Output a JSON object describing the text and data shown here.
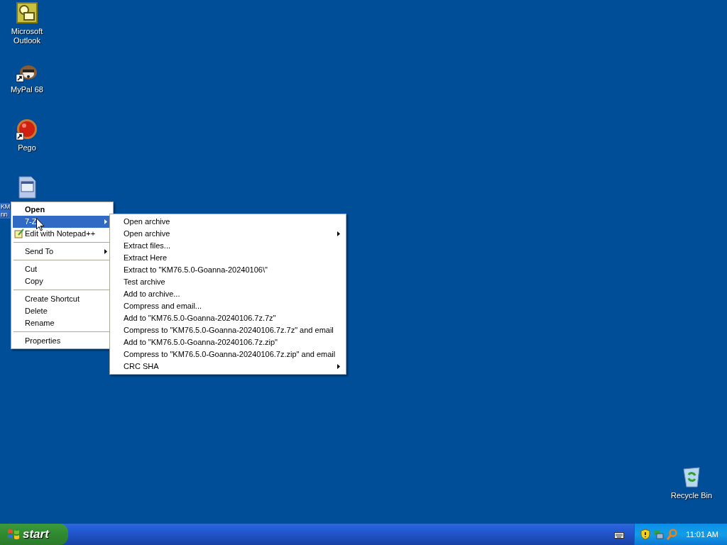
{
  "desktop_icons": [
    {
      "kind": "outlook",
      "label": [
        "Microsoft",
        "Outlook"
      ],
      "shortcut": false,
      "selected": false
    },
    {
      "kind": "raccoon",
      "label": [
        "MyPal 68"
      ],
      "shortcut": true,
      "selected": false
    },
    {
      "kind": "red-ball",
      "label": [
        "Pego"
      ],
      "shortcut": true,
      "selected": false
    },
    {
      "kind": "document",
      "label": [
        "KM",
        "nn"
      ],
      "shortcut": false,
      "selected": true
    }
  ],
  "recycle_bin": {
    "label": "Recycle Bin"
  },
  "context_menu": [
    {
      "kind": "item",
      "label": "Open",
      "default": true,
      "selected": false,
      "submenu": false
    },
    {
      "kind": "item",
      "label": "7-Z",
      "default": false,
      "selected": true,
      "submenu": true
    },
    {
      "kind": "icon-item",
      "label": "Edit with Notepad++",
      "default": false,
      "selected": false,
      "submenu": false
    },
    {
      "kind": "separator"
    },
    {
      "kind": "item",
      "label": "Send To",
      "default": false,
      "selected": false,
      "submenu": true
    },
    {
      "kind": "separator"
    },
    {
      "kind": "item",
      "label": "Cut",
      "default": false,
      "selected": false,
      "submenu": false
    },
    {
      "kind": "item",
      "label": "Copy",
      "default": false,
      "selected": false,
      "submenu": false
    },
    {
      "kind": "separator"
    },
    {
      "kind": "item",
      "label": "Create Shortcut",
      "default": false,
      "selected": false,
      "submenu": false
    },
    {
      "kind": "item",
      "label": "Delete",
      "default": false,
      "selected": false,
      "submenu": false
    },
    {
      "kind": "item",
      "label": "Rename",
      "default": false,
      "selected": false,
      "submenu": false
    },
    {
      "kind": "separator"
    },
    {
      "kind": "item",
      "label": "Properties",
      "default": false,
      "selected": false,
      "submenu": false
    }
  ],
  "submenu": [
    {
      "label": "Open archive",
      "selected": false,
      "submenu": false
    },
    {
      "label": "Open archive",
      "selected": false,
      "submenu": true
    },
    {
      "label": "Extract files...",
      "selected": false,
      "submenu": false
    },
    {
      "label": "Extract Here",
      "selected": false,
      "submenu": false
    },
    {
      "label": "Extract to \"KM76.5.0-Goanna-20240106\\\"",
      "selected": false,
      "submenu": false
    },
    {
      "label": "Test archive",
      "selected": false,
      "submenu": false
    },
    {
      "label": "Add to archive...",
      "selected": false,
      "submenu": false
    },
    {
      "label": "Compress and email...",
      "selected": false,
      "submenu": false
    },
    {
      "label": "Add to \"KM76.5.0-Goanna-20240106.7z.7z\"",
      "selected": false,
      "submenu": false
    },
    {
      "label": "Compress to \"KM76.5.0-Goanna-20240106.7z.7z\" and email",
      "selected": false,
      "submenu": false
    },
    {
      "label": "Add to \"KM76.5.0-Goanna-20240106.7z.zip\"",
      "selected": false,
      "submenu": false
    },
    {
      "label": "Compress to \"KM76.5.0-Goanna-20240106.7z.zip\" and email",
      "selected": false,
      "submenu": false
    },
    {
      "label": "CRC SHA",
      "selected": false,
      "submenu": true
    }
  ],
  "taskbar": {
    "start_label": "start",
    "clock": "11:01 AM"
  }
}
